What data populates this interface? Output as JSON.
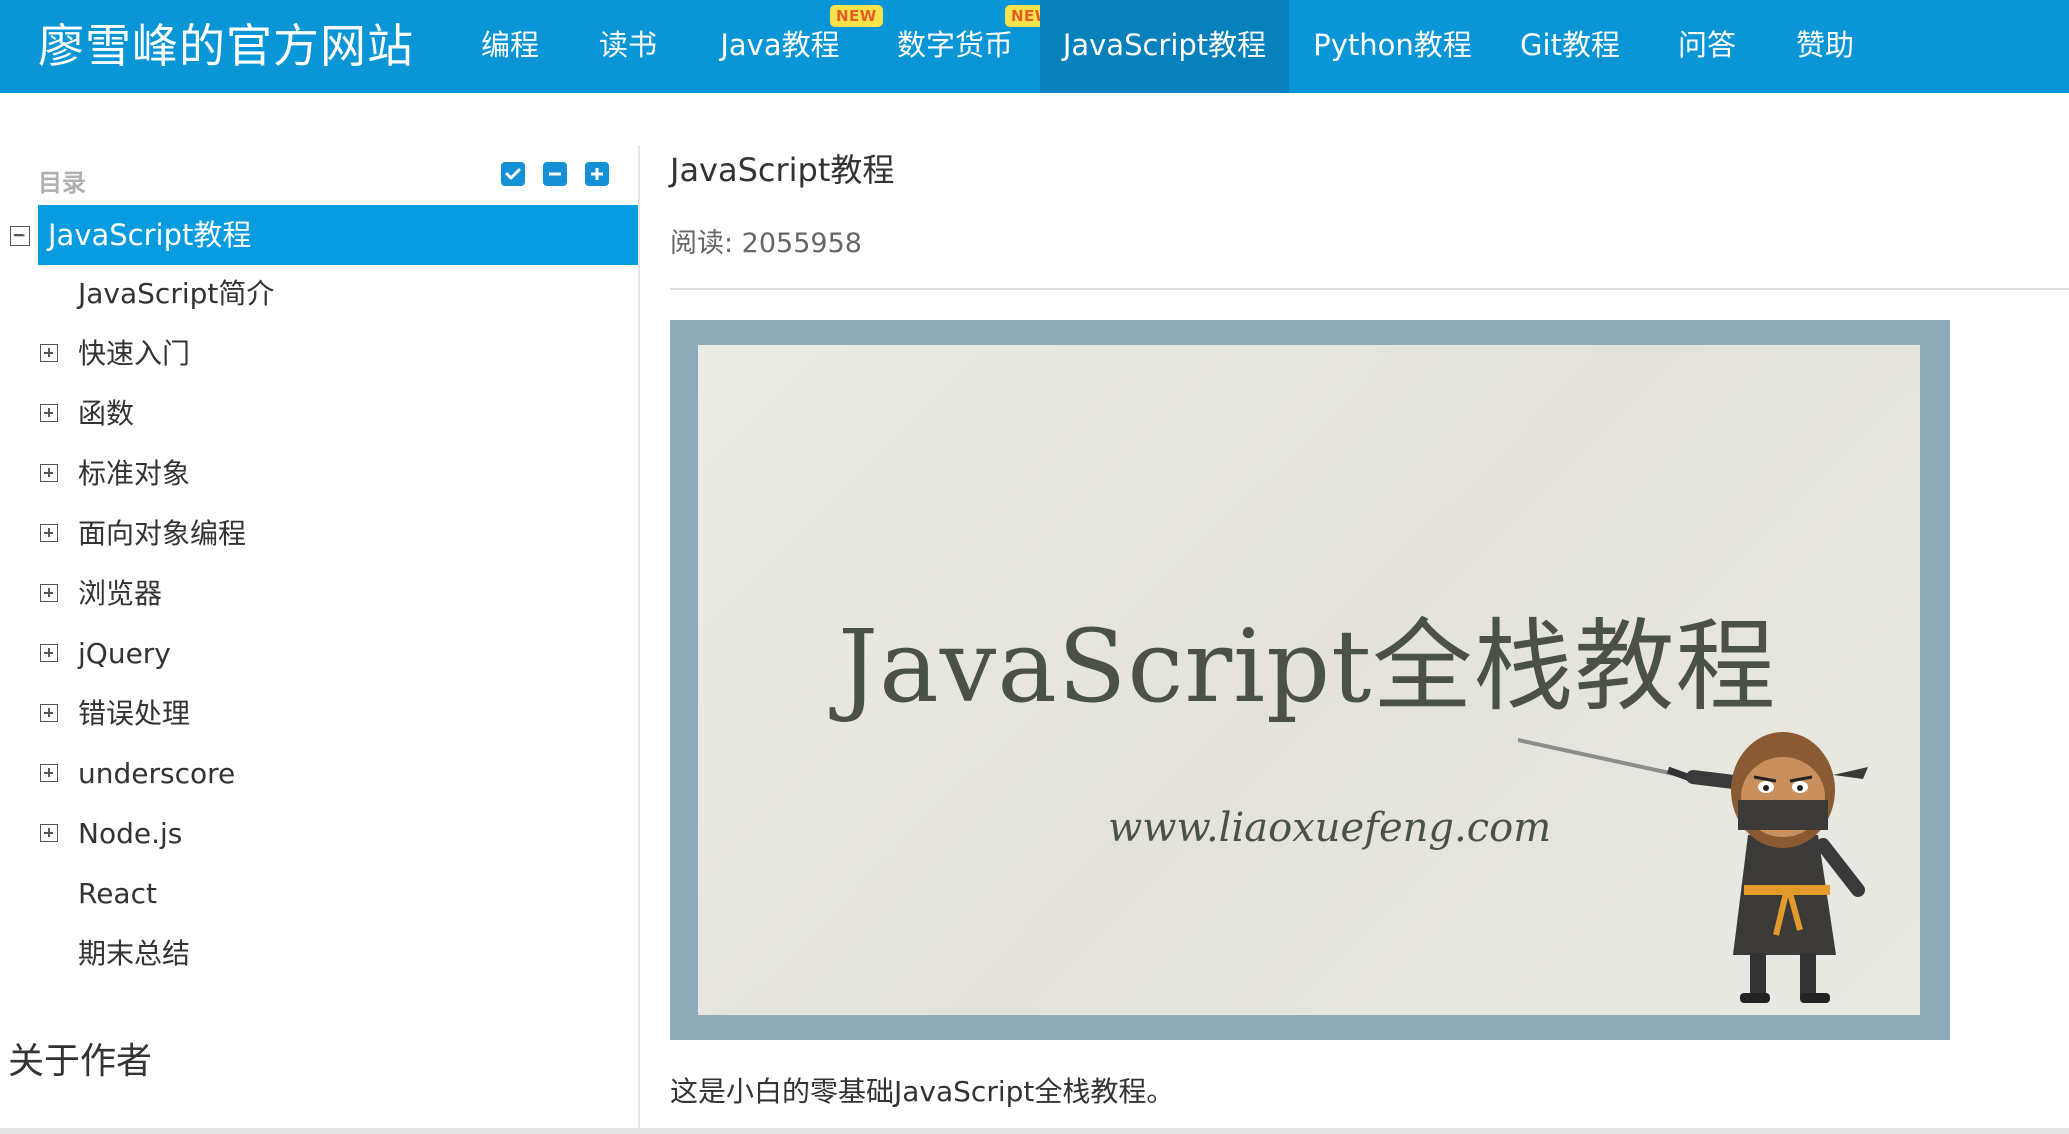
{
  "header": {
    "brand": "廖雪峰的官方网站",
    "nav": [
      {
        "label": "编程"
      },
      {
        "label": "读书"
      },
      {
        "label": "Java教程",
        "badge": "NEW"
      },
      {
        "label": "数字货币",
        "badge": "NEW"
      },
      {
        "label": "JavaScript教程",
        "active": true
      },
      {
        "label": "Python教程"
      },
      {
        "label": "Git教程"
      },
      {
        "label": "问答"
      },
      {
        "label": "赞助"
      }
    ]
  },
  "sidebar": {
    "title": "目录",
    "tools": [
      "check-icon",
      "collapse-all-icon",
      "expand-all-icon"
    ],
    "root": "JavaScript教程",
    "items": [
      {
        "label": "JavaScript简介",
        "expandable": false
      },
      {
        "label": "快速入门",
        "expandable": true
      },
      {
        "label": "函数",
        "expandable": true
      },
      {
        "label": "标准对象",
        "expandable": true
      },
      {
        "label": "面向对象编程",
        "expandable": true
      },
      {
        "label": "浏览器",
        "expandable": true
      },
      {
        "label": "jQuery",
        "expandable": true
      },
      {
        "label": "错误处理",
        "expandable": true
      },
      {
        "label": "underscore",
        "expandable": true
      },
      {
        "label": "Node.js",
        "expandable": true
      },
      {
        "label": "React",
        "expandable": false
      },
      {
        "label": "期末总结",
        "expandable": false
      }
    ],
    "about": "关于作者"
  },
  "main": {
    "title": "JavaScript教程",
    "read_count": "阅读: 2055958",
    "banner": {
      "heading": "JavaScript全栈教程",
      "url": "www.liaoxuefeng.com"
    },
    "caption": "这是小白的零基础JavaScript全栈教程。"
  },
  "colors": {
    "header_bg": "#0a96d6",
    "active_nav_bg": "#0781bb",
    "toc_highlight": "#079ce0",
    "badge_bg": "#f6e34c",
    "badge_text": "#e45d2a"
  }
}
